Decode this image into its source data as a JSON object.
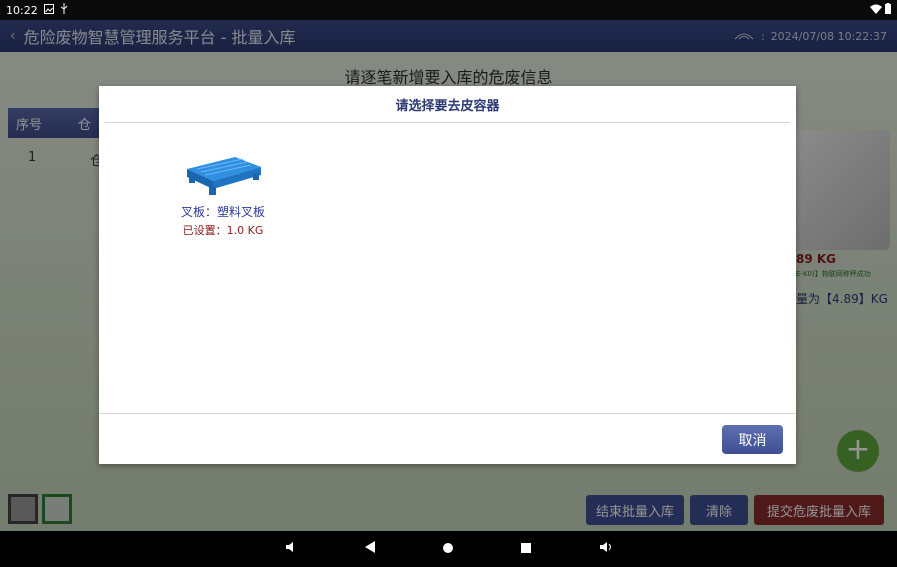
{
  "status_bar": {
    "time": "10:22",
    "icons": [
      "image-icon",
      "usb-icon",
      "wifi-icon",
      "battery-icon"
    ]
  },
  "header": {
    "title": "危险废物智慧管理服务平台 - 批量入库",
    "datetime": "2024/07/08 10:22:37"
  },
  "main": {
    "heading": "请逐笔新增要入库的危废信息",
    "table_header": [
      "序号",
      "仓"
    ],
    "row": {
      "index": "1",
      "first_char": "仓"
    },
    "weight_big": "89 KG",
    "weight_status": "E-K0)】物联网称秤成功",
    "weight_line": "量为【4.89】KG"
  },
  "bottom": {
    "end_batch_label": "结束批量入库",
    "clear_label": "清除",
    "submit_label": "提交危废批量入库"
  },
  "modal": {
    "title": "请选择要去皮容器",
    "container": {
      "name": "叉板：塑料叉板",
      "setting": "已设置：1.0 KG"
    },
    "cancel_label": "取消"
  },
  "colors": {
    "header_bg": "#2b3a72",
    "accent_blue": "#3d4f93",
    "submit_red": "#8b2b2b",
    "add_green": "#5ea73b"
  }
}
